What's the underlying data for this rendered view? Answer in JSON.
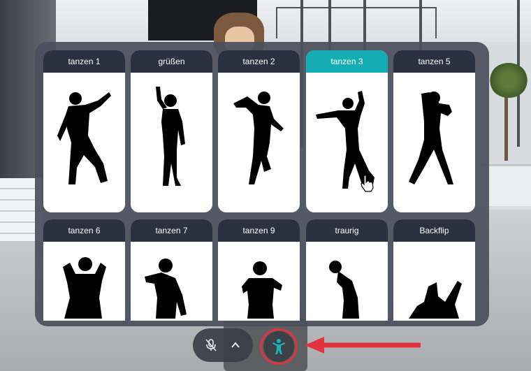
{
  "emotes": {
    "row1": [
      {
        "label": "tanzen 1",
        "active": false
      },
      {
        "label": "grüßen",
        "active": false
      },
      {
        "label": "tanzen 2",
        "active": false
      },
      {
        "label": "tanzen 3",
        "active": true
      },
      {
        "label": "tanzen 5",
        "active": false
      }
    ],
    "row2": [
      {
        "label": "tanzen 6"
      },
      {
        "label": "tanzen 7"
      },
      {
        "label": "tanzen 9"
      },
      {
        "label": "traurig"
      },
      {
        "label": "Backflip"
      }
    ]
  },
  "colors": {
    "card_header": "#2a3140",
    "card_header_active": "#14adb3",
    "panel_bg": "#4a505c",
    "annotation_red": "#e2323d",
    "emote_icon": "#19b3b8"
  },
  "toolbar": {
    "mic_icon": "microphone-muted-icon",
    "expand_icon": "chevron-up-icon",
    "emote_icon": "dancing-person-icon"
  }
}
